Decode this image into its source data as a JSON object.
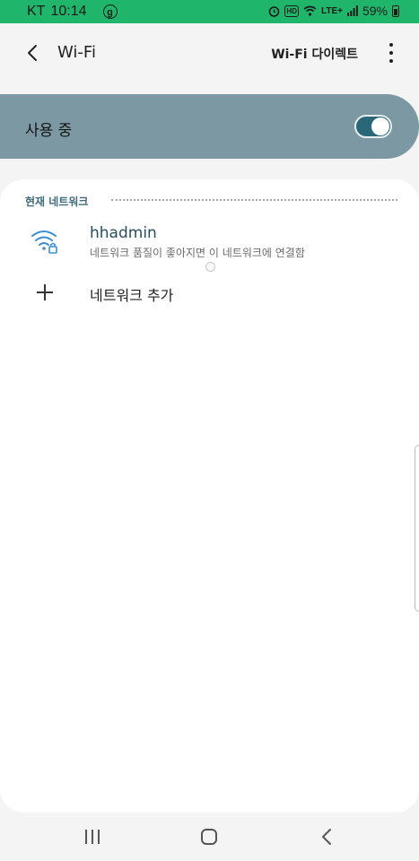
{
  "status_bar": {
    "carrier": "KT",
    "time": "10:14",
    "app_badge": "g",
    "hd_badge": "HD",
    "network": "LTE+",
    "battery": "59%"
  },
  "app_bar": {
    "title": "Wi-Fi",
    "wifi_direct_label": "Wi-Fi 다이렉트"
  },
  "master_switch": {
    "label": "사용 중",
    "enabled": true
  },
  "current_network": {
    "section_label": "현재 네트워크",
    "name": "hhadmin",
    "description": "네트워크 품질이 좋아지면 이 네트워크에 연결함",
    "secured": true
  },
  "add_network": {
    "label": "네트워크 추가"
  },
  "colors": {
    "status_bar": "#1fb66b",
    "master_bg": "#7c98a3",
    "accent": "#2a6779",
    "section_header": "#3f6b7c",
    "wifi_icon": "#3c8fd1"
  }
}
